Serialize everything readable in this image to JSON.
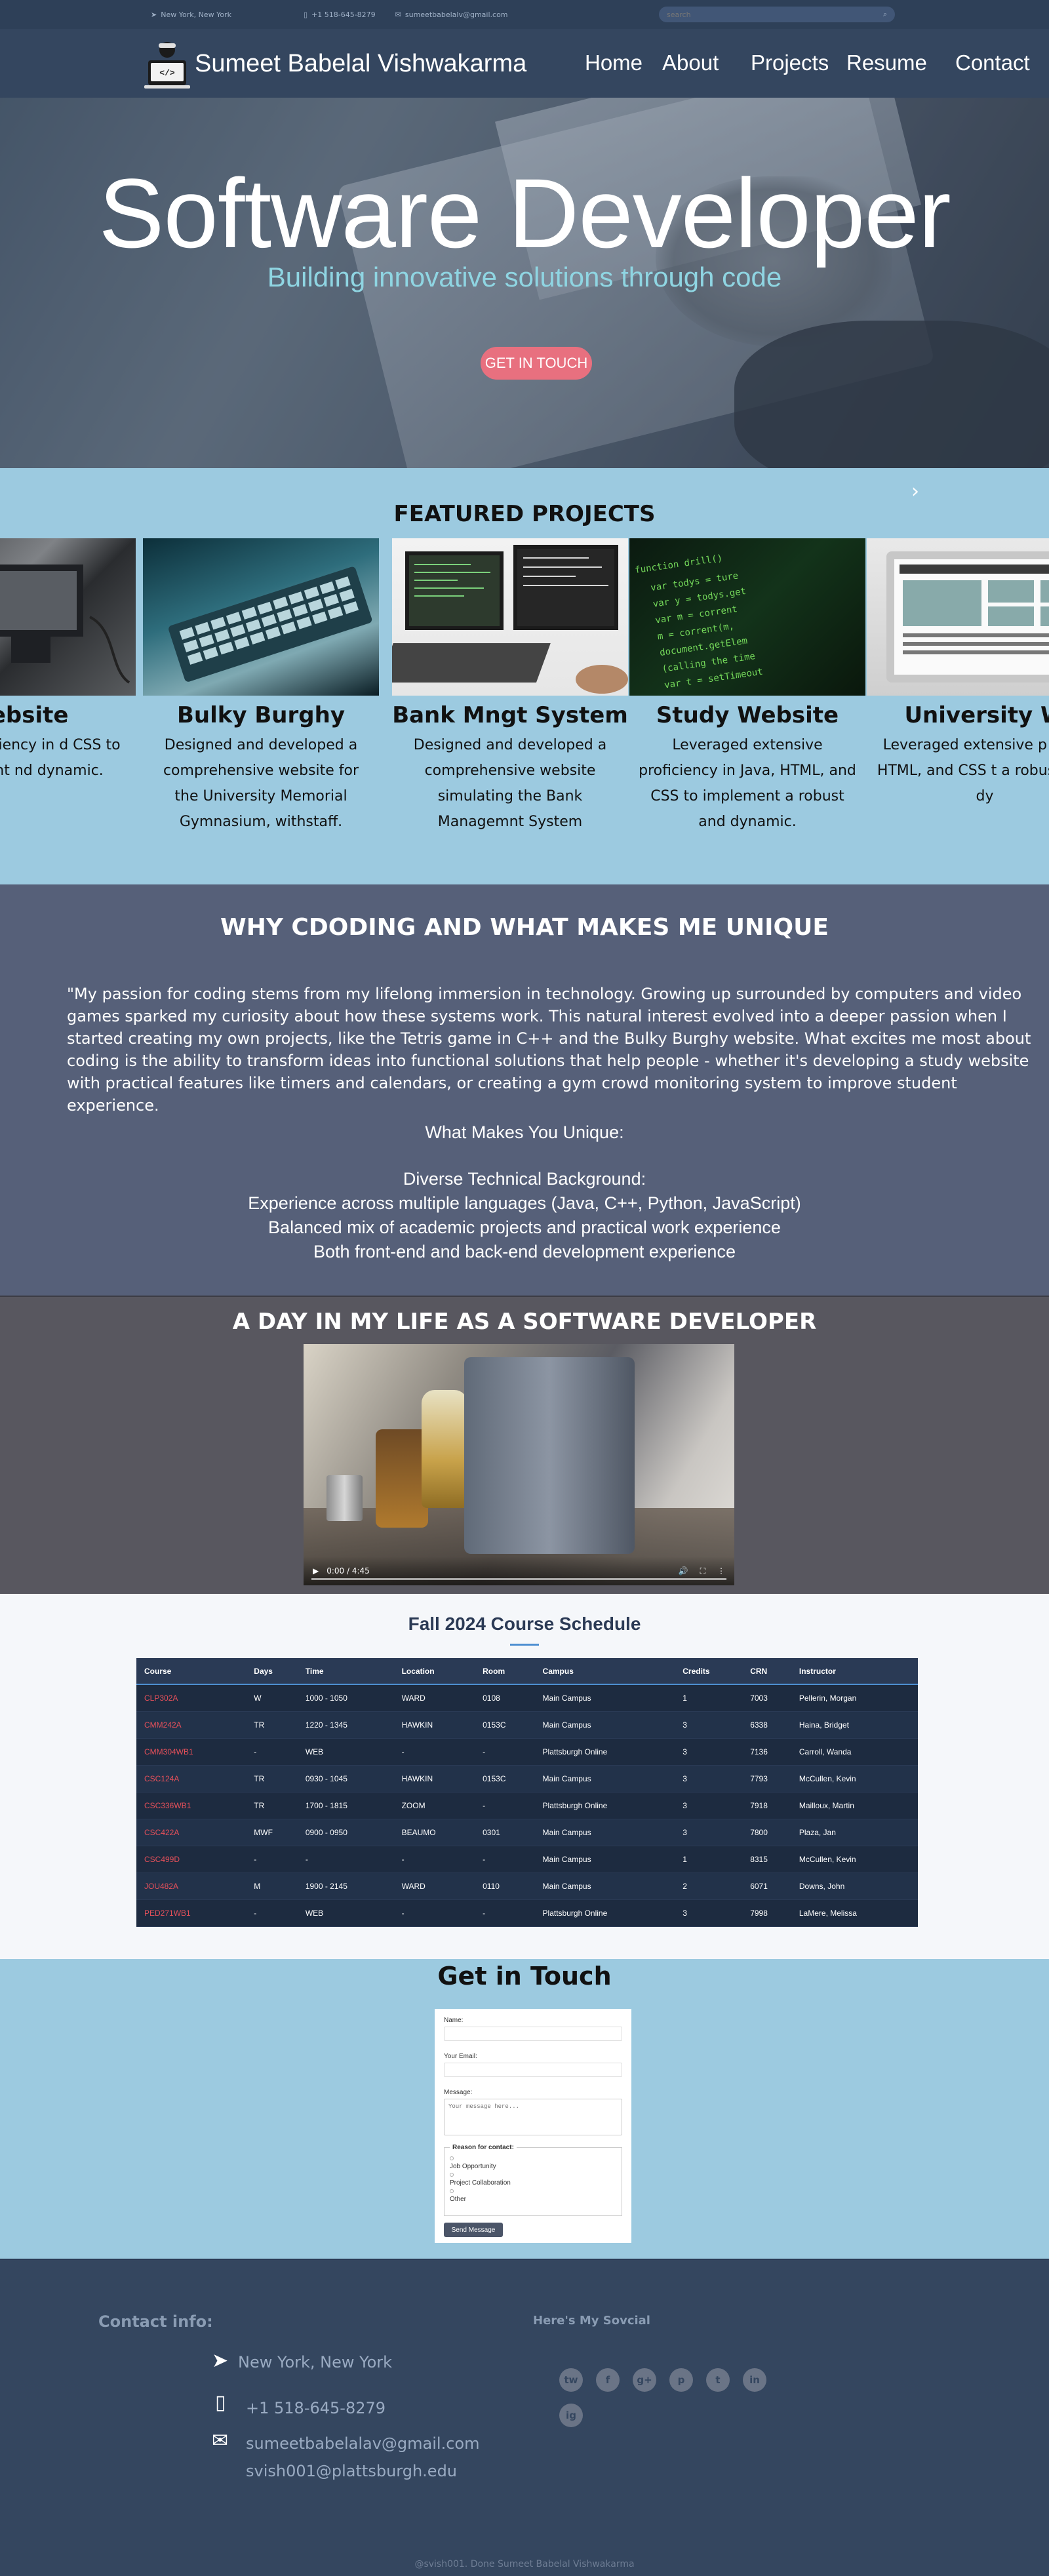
{
  "topbar": {
    "location": "New York, New York",
    "phone": "+1 518-645-8279",
    "email": "sumeetbabelalv@gmail.com",
    "search_placeholder": "search"
  },
  "header": {
    "brand": "Sumeet Babelal Vishwakarma",
    "nav": [
      "Home",
      "About",
      "Projects",
      "Resume",
      "Contact"
    ]
  },
  "hero": {
    "title": "Software Developer",
    "subtitle": "Building innovative solutions through code",
    "cta": "GET IN TOUCH"
  },
  "featured": {
    "title": "FEATURED PROJECTS",
    "next_icon": "›",
    "cards": [
      {
        "title": "Website",
        "desc": "nsive proficiency in d CSS to implement nd dynamic."
      },
      {
        "title": "Bulky Burghy",
        "desc": "Designed and developed a comprehensive website for the University Memorial Gymnasium, withstaff."
      },
      {
        "title": "Bank  Mngt System",
        "desc": "Designed and developed a comprehensive website simulating the Bank Managemnt System"
      },
      {
        "title": "Study Website",
        "desc": "Leveraged extensive proficiency in Java, HTML, and CSS to implement a robust and dynamic."
      },
      {
        "title": "University W",
        "desc": "Leveraged extensive p Java, HTML, and CSS t a robust and dy"
      }
    ]
  },
  "why": {
    "title": "WHY CDODING AND WHAT MAKES ME UNIQUE",
    "quote": "\"My passion for coding stems from my lifelong immersion in technology. Growing up surrounded by computers and video games sparked my curiosity about how these systems work. This natural interest evolved into a deeper passion when I started creating my own projects, like the Tetris game in C++ and the Bulky Burghy website. What excites me most about coding is the ability to transform ideas into functional solutions that help people - whether it's developing a study website with practical features like timers and calendars, or creating a gym crowd monitoring system to improve student experience.",
    "unique_heading": "What Makes You Unique:",
    "points": [
      "Diverse Technical Background:",
      "Experience across multiple languages (Java, C++, Python, JavaScript)",
      "Balanced mix of academic projects and practical work experience",
      "Both front-end and back-end development experience"
    ]
  },
  "day": {
    "title": "A DAY IN MY LIFE AS A SOFTWARE DEVELOPER",
    "time": "0:00 / 4:45"
  },
  "schedule": {
    "title": "Fall 2024 Course Schedule",
    "headers": [
      "Course",
      "Days",
      "Time",
      "Location",
      "Room",
      "Campus",
      "Credits",
      "CRN",
      "Instructor"
    ],
    "rows": [
      [
        "CLP302A",
        "W",
        "1000 - 1050",
        "WARD",
        "0108",
        "Main Campus",
        "1",
        "7003",
        "Pellerin, Morgan"
      ],
      [
        "CMM242A",
        "TR",
        "1220 - 1345",
        "HAWKIN",
        "0153C",
        "Main Campus",
        "3",
        "6338",
        "Haina, Bridget"
      ],
      [
        "CMM304WB1",
        "-",
        "WEB",
        "-",
        "-",
        "Plattsburgh Online",
        "3",
        "7136",
        "Carroll, Wanda"
      ],
      [
        "CSC124A",
        "TR",
        "0930 - 1045",
        "HAWKIN",
        "0153C",
        "Main Campus",
        "3",
        "7793",
        "McCullen, Kevin"
      ],
      [
        "CSC336WB1",
        "TR",
        "1700 - 1815",
        "ZOOM",
        "-",
        "Plattsburgh Online",
        "3",
        "7918",
        "Mailloux, Martin"
      ],
      [
        "CSC422A",
        "MWF",
        "0900 - 0950",
        "BEAUMO",
        "0301",
        "Main Campus",
        "3",
        "7800",
        "Plaza, Jan"
      ],
      [
        "CSC499D",
        "-",
        "-",
        "-",
        "-",
        "Main Campus",
        "1",
        "8315",
        "McCullen, Kevin"
      ],
      [
        "JOU482A",
        "M",
        "1900 - 2145",
        "WARD",
        "0110",
        "Main Campus",
        "2",
        "6071",
        "Downs, John"
      ],
      [
        "PED271WB1",
        "-",
        "WEB",
        "-",
        "-",
        "Plattsburgh Online",
        "3",
        "7998",
        "LaMere, Melissa"
      ]
    ]
  },
  "contact": {
    "title": "Get in Touch",
    "name_label": "Name:",
    "email_label": "Your Email:",
    "message_label": "Message:",
    "message_placeholder": "Your message here...",
    "reason_legend": "Reason for contact:",
    "reasons": [
      "Job Opportunity",
      "Project Collaboration",
      "Other"
    ],
    "send": "Send Message"
  },
  "footer": {
    "contact_title": "Contact info:",
    "social_title": "Here's My Sovcial",
    "location": "New York, New York",
    "phone": "+1 518-645-8279",
    "email1": "sumeetbabelalav@gmail.com",
    "email2": "svish001@plattsburgh.edu",
    "social": [
      "tw",
      "f",
      "g+",
      "p",
      "t",
      "in",
      "ig"
    ],
    "copyright": "@svish001. Done Sumeet Babelal Vishwakarma"
  }
}
